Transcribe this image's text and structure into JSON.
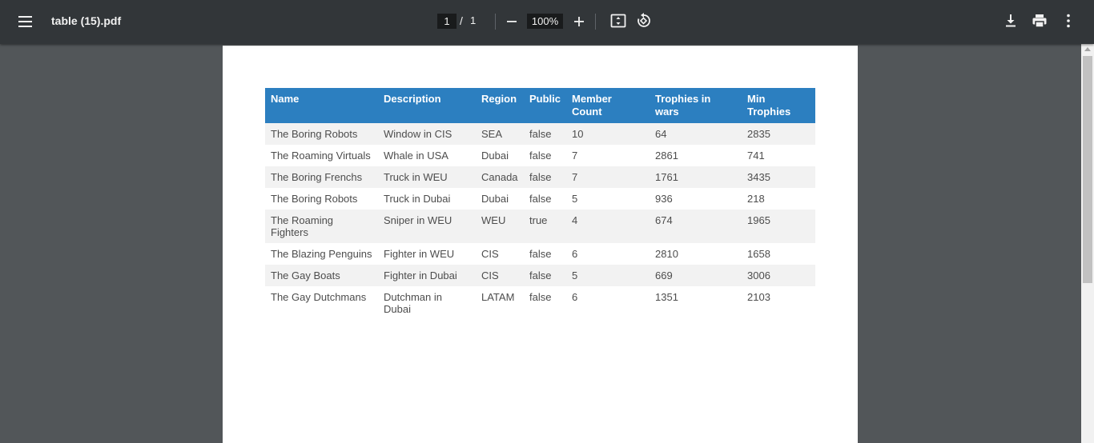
{
  "toolbar": {
    "title": "table (15).pdf",
    "page_current": "1",
    "page_separator": "/",
    "page_total": "1",
    "zoom": "100%",
    "icons": [
      "menu-icon",
      "minus-icon",
      "plus-icon",
      "fit-page-icon",
      "rotate-icon",
      "download-icon",
      "print-icon",
      "more-vert-icon"
    ]
  },
  "table": {
    "headers": [
      "Name",
      "Description",
      "Region",
      "Public",
      "Member Count",
      "Trophies in wars",
      "Min Trophies"
    ],
    "rows": [
      [
        "The Boring Robots",
        "Window in CIS",
        "SEA",
        "false",
        "10",
        "64",
        "2835"
      ],
      [
        "The Roaming Virtuals",
        "Whale in USA",
        "Dubai",
        "false",
        "7",
        "2861",
        "741"
      ],
      [
        "The Boring Frenchs",
        "Truck in WEU",
        "Canada",
        "false",
        "7",
        "1761",
        "3435"
      ],
      [
        "The Boring Robots",
        "Truck in Dubai",
        "Dubai",
        "false",
        "5",
        "936",
        "218"
      ],
      [
        "The Roaming Fighters",
        "Sniper in WEU",
        "WEU",
        "true",
        "4",
        "674",
        "1965"
      ],
      [
        "The Blazing Penguins",
        "Fighter in WEU",
        "CIS",
        "false",
        "6",
        "2810",
        "1658"
      ],
      [
        "The Gay Boats",
        "Fighter in Dubai",
        "CIS",
        "false",
        "5",
        "669",
        "3006"
      ],
      [
        "The Gay Dutchmans",
        "Dutchman in Dubai",
        "LATAM",
        "false",
        "6",
        "1351",
        "2103"
      ]
    ]
  },
  "colors": {
    "toolbar_bg": "#323639",
    "viewer_bg": "#525659",
    "header_bg": "#2c7fc0",
    "stripe_bg": "#f2f2f2"
  }
}
